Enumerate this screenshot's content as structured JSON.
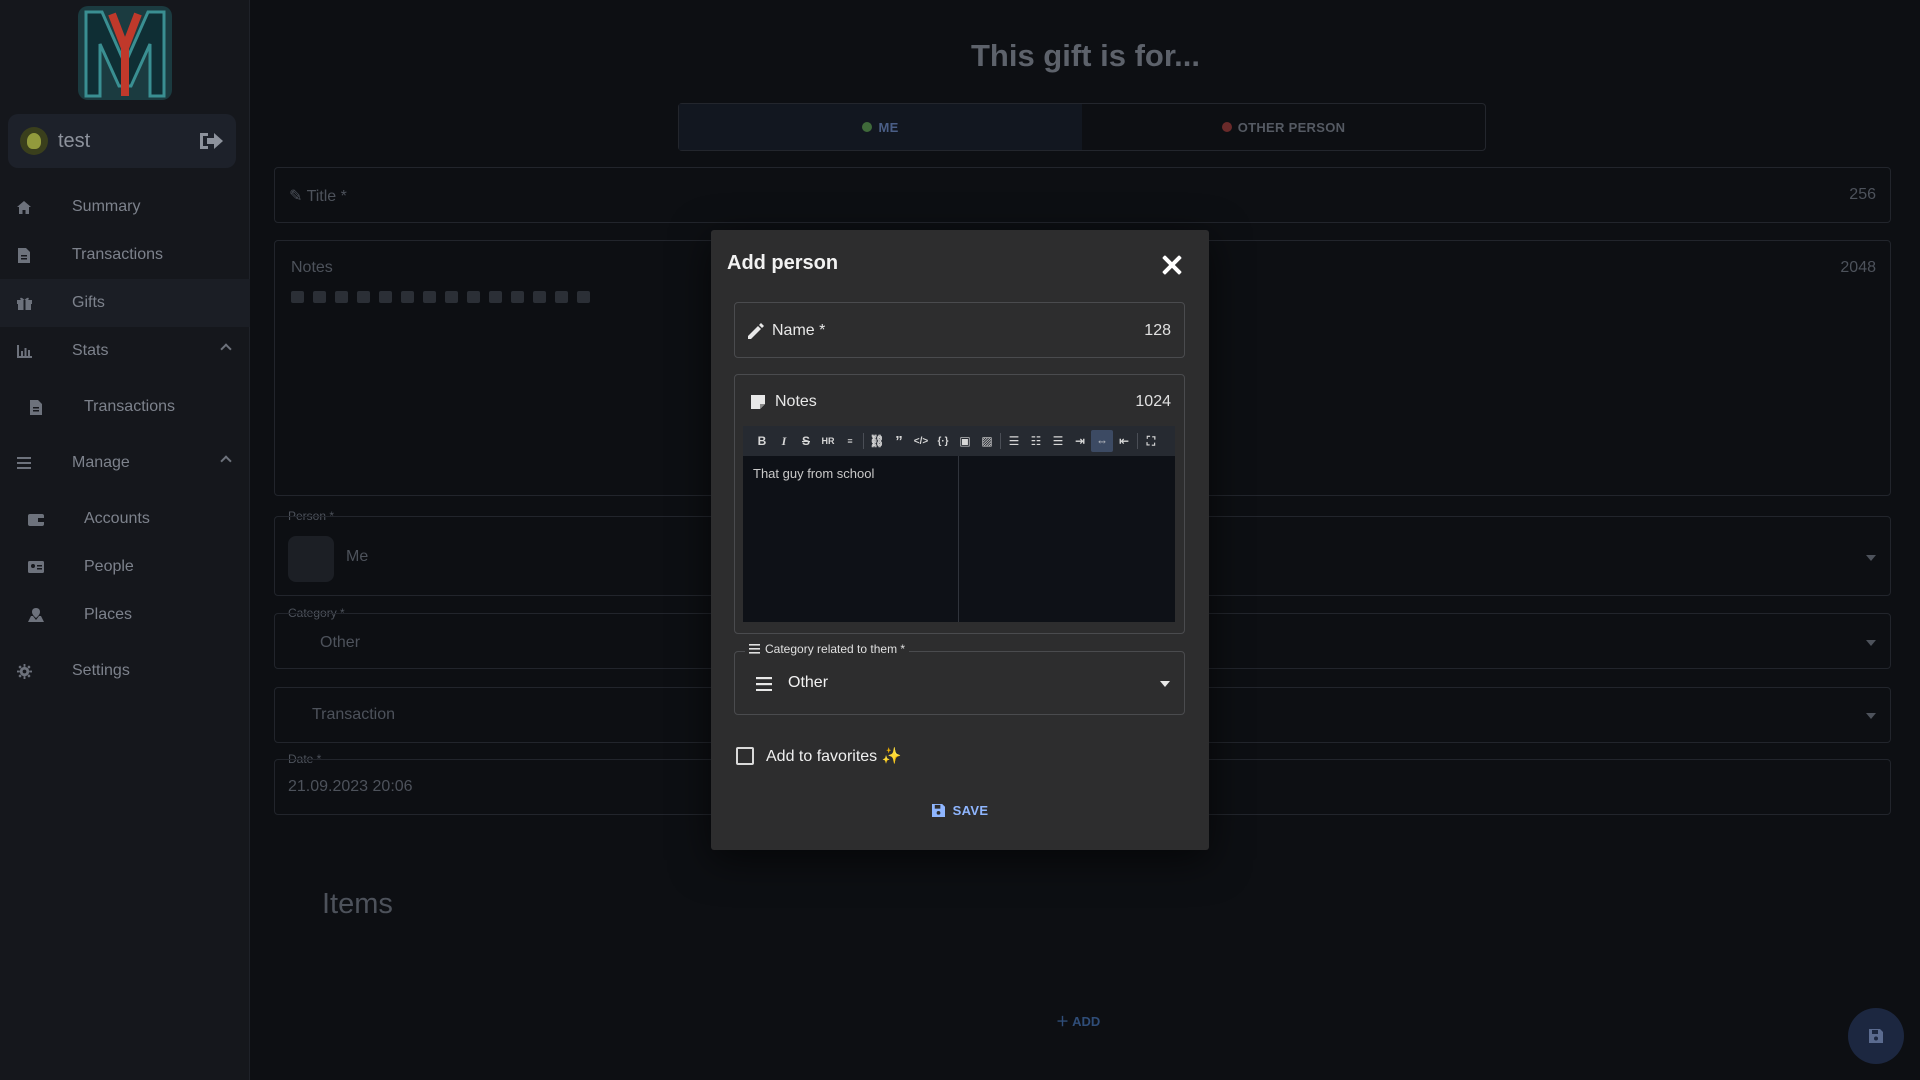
{
  "sidebar": {
    "user": {
      "name": "test"
    },
    "items": [
      {
        "label": "Summary",
        "icon": "home-icon"
      },
      {
        "label": "Transactions",
        "icon": "receipt-icon"
      },
      {
        "label": "Gifts",
        "icon": "gift-icon",
        "active": true
      },
      {
        "label": "Stats",
        "icon": "chart-icon",
        "expanded": true
      },
      {
        "label": "Transactions",
        "icon": "receipt-icon",
        "sub": true
      },
      {
        "label": "Manage",
        "icon": "menu-icon",
        "expanded": true
      },
      {
        "label": "Accounts",
        "icon": "wallet-icon",
        "sub": true
      },
      {
        "label": "People",
        "icon": "id-card-icon",
        "sub": true
      },
      {
        "label": "Places",
        "icon": "map-icon",
        "sub": true
      },
      {
        "label": "Settings",
        "icon": "gear-icon"
      }
    ]
  },
  "main": {
    "title": "This gift is for...",
    "toggle": {
      "me": "ME",
      "other": "OTHER PERSON"
    },
    "title_field": {
      "label": "Title *",
      "counter": "256"
    },
    "notes_field": {
      "label": "Notes",
      "counter": "2048"
    },
    "person_field": {
      "legend": "Person *",
      "value": "Me"
    },
    "category_field": {
      "legend": "Category *",
      "value": "Other"
    },
    "transaction_field": {
      "label": "Transaction"
    },
    "date_field": {
      "legend": "Date *",
      "value": "21.09.2023 20:06"
    },
    "items_title": "Items",
    "add_label": "ADD"
  },
  "dialog": {
    "title": "Add person",
    "name_field": {
      "label": "Name *",
      "counter": "128"
    },
    "notes_field": {
      "label": "Notes",
      "counter": "1024",
      "value": "That guy from school"
    },
    "category_field": {
      "legend": "Category related to them *",
      "value": "Other"
    },
    "favorites_label": "Add to favorites ✨",
    "favorites_checked": false,
    "save_label": "SAVE"
  },
  "colors": {
    "accent": "#8fb6ff",
    "dialog_bg": "#2d2d2e",
    "page_bg": "#0d0f13"
  }
}
